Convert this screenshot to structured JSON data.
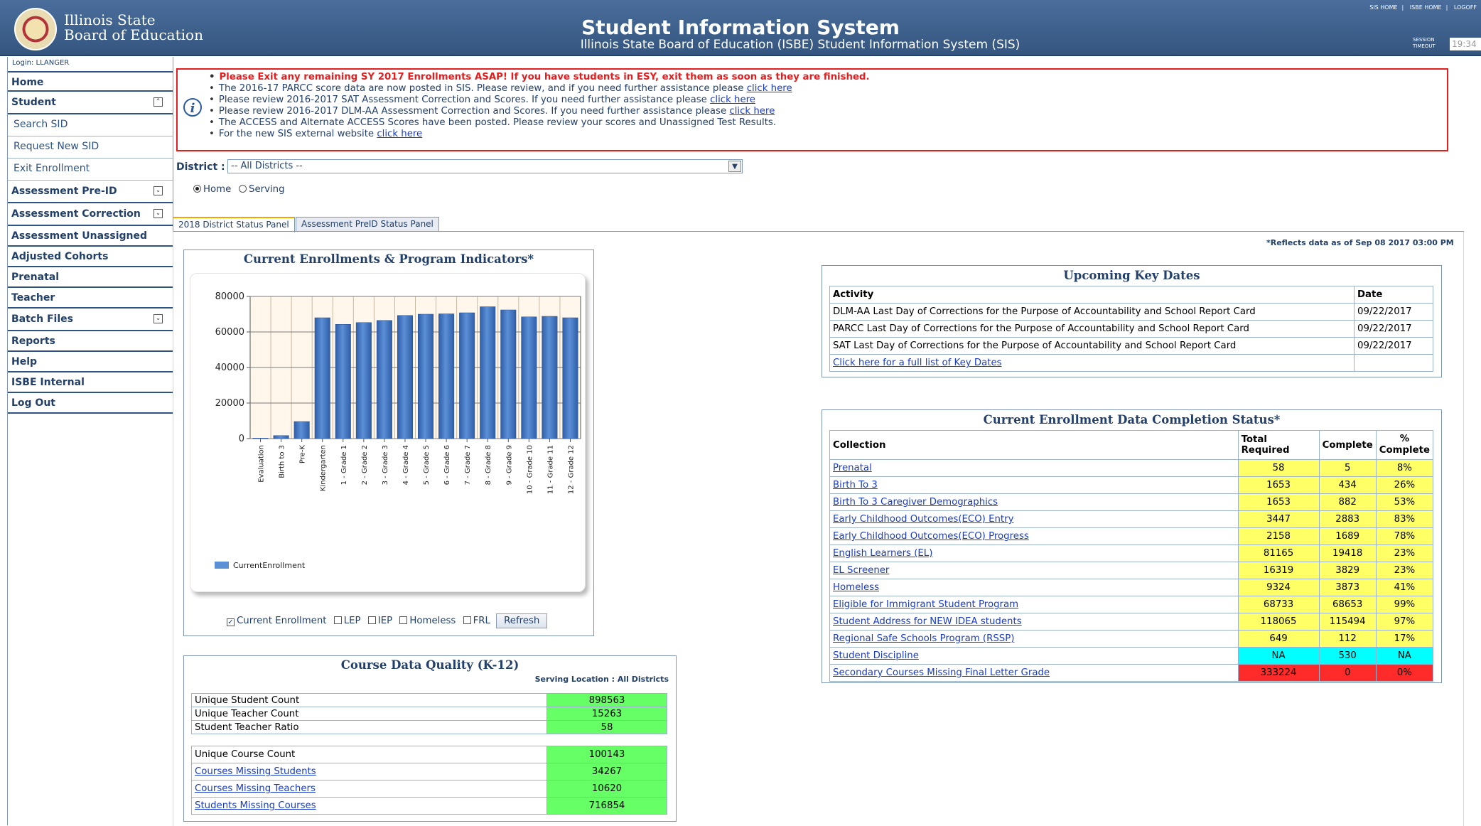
{
  "header": {
    "logo_line1": "Illinois State",
    "logo_line2": "Board of Education",
    "title": "Student Information System",
    "subtitle": "Illinois State Board of Education (ISBE) Student Information System (SIS)",
    "top_links": [
      "SIS HOME",
      "ISBE HOME",
      "LOGOFF"
    ],
    "session_label_1": "SESSION",
    "session_label_2": "TIMEOUT",
    "session_time": "19:34"
  },
  "sidebar": {
    "login": "Login: LLANGER",
    "items": [
      {
        "label": "Home"
      },
      {
        "label": "Student"
      },
      {
        "label": "Search SID"
      },
      {
        "label": "Request New SID"
      },
      {
        "label": "Exit Enrollment"
      },
      {
        "label": "Assessment Pre-ID"
      },
      {
        "label": "Assessment Correction"
      },
      {
        "label": "Assessment Unassigned"
      },
      {
        "label": "Adjusted Cohorts"
      },
      {
        "label": "Prenatal"
      },
      {
        "label": "Teacher"
      },
      {
        "label": "Batch Files"
      },
      {
        "label": "Reports"
      },
      {
        "label": "Help"
      },
      {
        "label": "ISBE Internal"
      },
      {
        "label": "Log Out"
      }
    ]
  },
  "notice": {
    "line1": "Please Exit any remaining SY 2017 Enrollments ASAP! If you have students in ESY, exit them as soon as they are finished.",
    "line2": "The 2016-17 PARCC score data are now posted in SIS. Please review, and if you need further assistance please",
    "line3": "Please review 2016-2017 SAT Assessment Correction and Scores. If you need further assistance please",
    "line4": "Please review 2016-2017 DLM-AA Assessment Correction and Scores. If you need further assistance please",
    "line5": "The ACCESS and Alternate ACCESS Scores have been posted. Please review your scores and Unassigned Test Results.",
    "line6": "For the new SIS external website",
    "link": "click here"
  },
  "filter": {
    "district_label": "District :",
    "district_value": "-- All Districts --",
    "radio_home": "Home",
    "radio_serving": "Serving"
  },
  "tabs": [
    "2018 District Status Panel",
    "Assessment PreID Status Panel"
  ],
  "asof": "*Reflects data as of Sep 08 2017 03:00 PM",
  "enrollment_box": {
    "title": "Current Enrollments & Program Indicators*",
    "controls": {
      "current": "Current Enrollment",
      "lep": "LEP",
      "iep": "IEP",
      "homeless": "Homeless",
      "frl": "FRL",
      "refresh": "Refresh"
    }
  },
  "chart_data": {
    "type": "bar",
    "title": "Current Enrollments & Program Indicators*",
    "categories": [
      "Evaluation",
      "Birth to 3",
      "Pre-K",
      "Kindergarten",
      "1 - Grade 1",
      "2 - Grade 2",
      "3 - Grade 3",
      "4 - Grade 4",
      "5 - Grade 5",
      "6 - Grade 6",
      "7 - Grade 7",
      "8 - Grade 8",
      "9 - Grade 9",
      "10 - Grade 10",
      "11 - Grade 11",
      "12 - Grade 12"
    ],
    "series": [
      {
        "name": "CurrentEnrollment",
        "values": [
          300,
          1700,
          9600,
          68000,
          64300,
          65300,
          66500,
          69300,
          70000,
          70200,
          70800,
          74200,
          72400,
          68500,
          68800,
          68000
        ]
      }
    ],
    "yticks": [
      0,
      20000,
      40000,
      60000,
      80000
    ],
    "ylim": [
      0,
      80000
    ],
    "legend": "bottom-left",
    "grid": true,
    "colors": {
      "bar": "#5b8fd6",
      "bar_dark": "#2f5ea8",
      "plot_bg": "#fff7ec"
    }
  },
  "key_dates": {
    "title": "Upcoming Key Dates",
    "headers": [
      "Activity",
      "Date"
    ],
    "rows": [
      {
        "activity": "DLM-AA Last Day of Corrections for the Purpose of Accountability and School Report Card",
        "date": "09/22/2017"
      },
      {
        "activity": "PARCC Last Day of Corrections for the Purpose of Accountability and School Report Card",
        "date": "09/22/2017"
      },
      {
        "activity": "SAT Last Day of Corrections for the Purpose of Accountability and School Report Card",
        "date": "09/22/2017"
      }
    ],
    "full_list_link": "Click here for a full list of Key Dates"
  },
  "completion": {
    "title": "Current Enrollment Data Completion Status*",
    "headers": [
      "Collection",
      "Total Required",
      "Complete",
      "%",
      "Complete"
    ],
    "rows": [
      {
        "collection": "Prenatal",
        "total": "58",
        "complete": "5",
        "pct": "8%"
      },
      {
        "collection": "Birth To 3",
        "total": "1653",
        "complete": "434",
        "pct": "26%"
      },
      {
        "collection": "Birth To 3 Caregiver Demographics",
        "total": "1653",
        "complete": "882",
        "pct": "53%"
      },
      {
        "collection": "Early Childhood Outcomes(ECO) Entry",
        "total": "3447",
        "complete": "2883",
        "pct": "83%"
      },
      {
        "collection": "Early Childhood Outcomes(ECO) Progress",
        "total": "2158",
        "complete": "1689",
        "pct": "78%"
      },
      {
        "collection": "English Learners (EL)",
        "total": "81165",
        "complete": "19418",
        "pct": "23%"
      },
      {
        "collection": "EL Screener",
        "total": "16319",
        "complete": "3829",
        "pct": "23%"
      },
      {
        "collection": "Homeless",
        "total": "9324",
        "complete": "3873",
        "pct": "41%"
      },
      {
        "collection": "Eligible for Immigrant Student Program",
        "total": "68733",
        "complete": "68653",
        "pct": "99%"
      },
      {
        "collection": "Student Address for NEW IDEA students",
        "total": "118065",
        "complete": "115494",
        "pct": "97%"
      },
      {
        "collection": "Regional Safe Schools Program (RSSP)",
        "total": "649",
        "complete": "112",
        "pct": "17%"
      },
      {
        "collection": "Student Discipline",
        "total": "NA",
        "complete": "530",
        "pct": "NA"
      },
      {
        "collection": "Secondary Courses Missing Final Letter Grade",
        "total": "333224",
        "complete": "0",
        "pct": "0%"
      }
    ]
  },
  "course_quality": {
    "title": "Course Data Quality (K-12)",
    "serving": "Serving Location : All Districts",
    "group1": [
      {
        "label": "Unique Student Count",
        "value": "898563"
      },
      {
        "label": "Unique Teacher Count",
        "value": "15263"
      },
      {
        "label": "Student Teacher Ratio",
        "value": "58"
      }
    ],
    "group2": [
      {
        "label": "Unique Course Count",
        "value": "100143"
      },
      {
        "label": "Courses Missing Students",
        "value": "34267"
      },
      {
        "label": "Courses Missing Teachers",
        "value": "10620"
      },
      {
        "label": "Students Missing Courses",
        "value": "716854"
      }
    ]
  }
}
